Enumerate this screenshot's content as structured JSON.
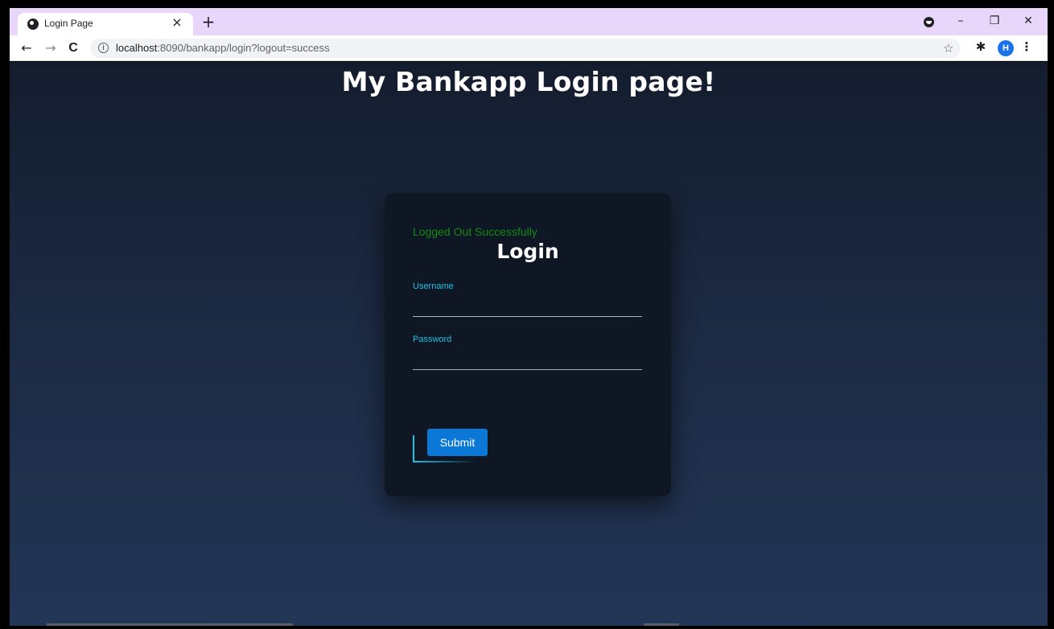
{
  "browser": {
    "tab_title": "Login Page",
    "tab_close": "×",
    "new_tab": "+",
    "url_host": "localhost",
    "url_path": ":8090/bankapp/login?logout=success",
    "avatar_letter": "H",
    "window_controls": {
      "minimize": "–",
      "restore": "❐",
      "close": "✕"
    },
    "nav": {
      "back": "←",
      "forward": "→",
      "reload": "C"
    },
    "star": "☆",
    "extensions": "✱",
    "menu": "⋮"
  },
  "page": {
    "title": "My Bankapp Login page!"
  },
  "login_card": {
    "status_message": "Logged Out Successfully",
    "heading": "Login",
    "username_label": "Username",
    "username_value": "",
    "password_label": "Password",
    "password_value": "",
    "submit_label": "Submit"
  },
  "colors": {
    "tabstrip": "#e9d7fb",
    "page_bg_top": "#141d2e",
    "page_bg_bottom": "#233657",
    "card_bg": "#0f1724",
    "status_green": "#128a12",
    "label_cyan": "#19c3e6",
    "submit_blue": "#0b78d8"
  }
}
